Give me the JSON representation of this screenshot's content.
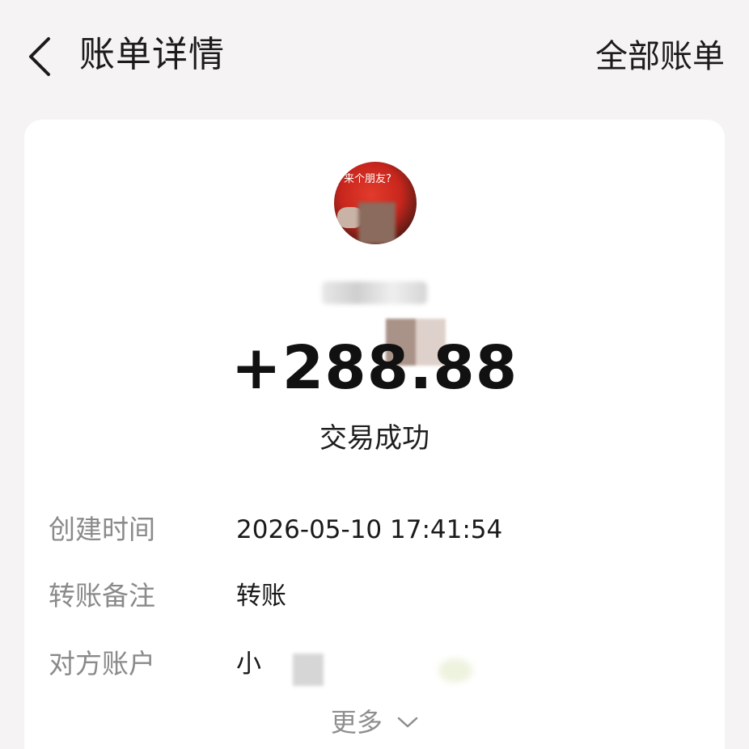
{
  "header": {
    "title": "账单详情",
    "right_link": "全部账单"
  },
  "avatar": {
    "caption": "来个朋友?"
  },
  "transaction": {
    "amount": "+288.88",
    "status": "交易成功"
  },
  "details": [
    {
      "label": "创建时间",
      "value": "2026-05-10 17:41:54"
    },
    {
      "label": "转账备注",
      "value": "转账"
    },
    {
      "label": "对方账户",
      "value": "小"
    }
  ],
  "more": {
    "label": "更多"
  },
  "icons": {
    "back": "chevron-left-icon",
    "more": "chevron-down-icon"
  },
  "colors": {
    "background": "#f6f3f4",
    "card": "#ffffff",
    "label_gray": "#8a8a8a",
    "text_dark": "#111111"
  }
}
